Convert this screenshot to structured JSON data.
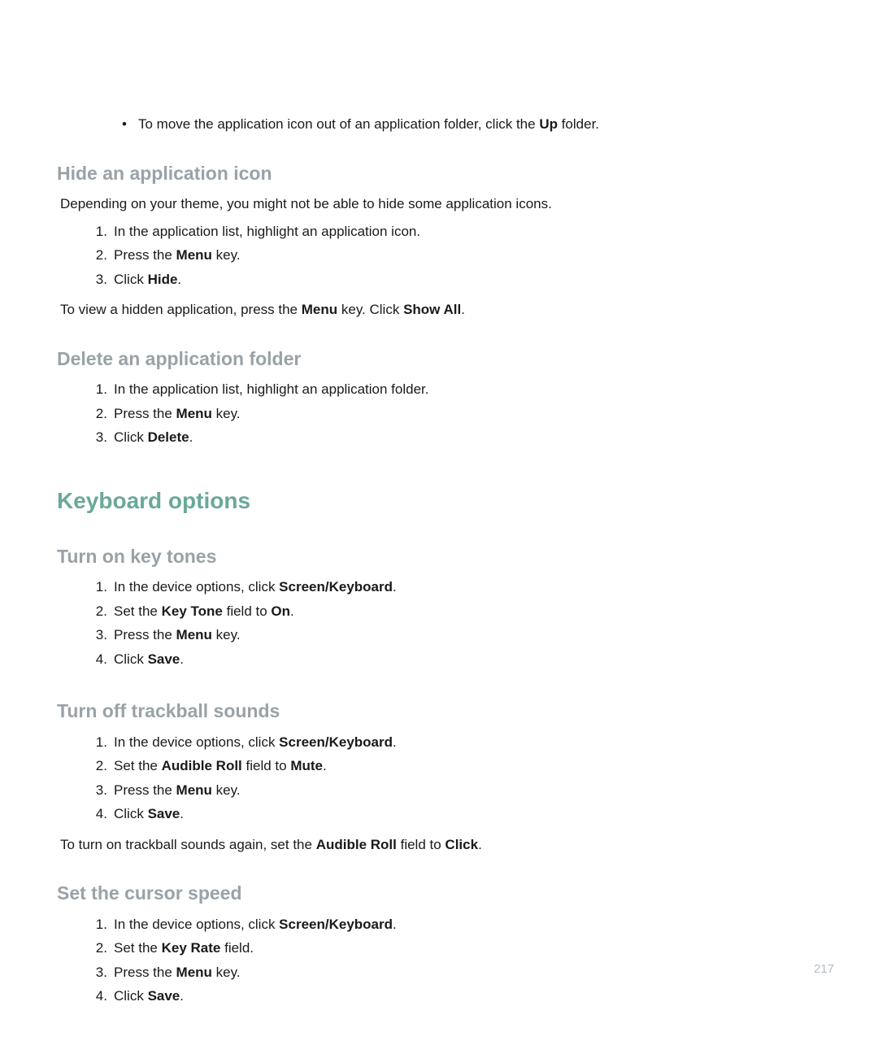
{
  "intro_bullet": {
    "prefix": "To move the application icon out of an application folder, click the ",
    "bold": "Up",
    "suffix": " folder."
  },
  "sec1": {
    "title": "Hide an application icon",
    "para1": "Depending on your theme, you might not be able to hide some application icons.",
    "step1": "In the application list, highlight an application icon.",
    "step2_prefix": "Press the ",
    "step2_bold": "Menu",
    "step2_suffix": " key.",
    "step3_prefix": "Click ",
    "step3_bold": "Hide",
    "step3_suffix": ".",
    "para2_prefix": "To view a hidden application, press the ",
    "para2_bold1": "Menu",
    "para2_mid": " key. Click ",
    "para2_bold2": "Show All",
    "para2_suffix": "."
  },
  "sec2": {
    "title": "Delete an application folder",
    "step1": "In the application list, highlight an application folder.",
    "step2_prefix": "Press the ",
    "step2_bold": "Menu",
    "step2_suffix": " key.",
    "step3_prefix": "Click ",
    "step3_bold": "Delete",
    "step3_suffix": "."
  },
  "main_heading": "Keyboard options",
  "sec3": {
    "title": "Turn on key tones",
    "step1_prefix": "In the device options, click ",
    "step1_bold": "Screen/Keyboard",
    "step1_suffix": ".",
    "step2_prefix": "Set the ",
    "step2_bold1": "Key Tone",
    "step2_mid": " field to ",
    "step2_bold2": "On",
    "step2_suffix": ".",
    "step3_prefix": "Press the ",
    "step3_bold": "Menu",
    "step3_suffix": " key.",
    "step4_prefix": "Click ",
    "step4_bold": "Save",
    "step4_suffix": "."
  },
  "sec4": {
    "title": "Turn off trackball sounds",
    "step1_prefix": "In the device options, click ",
    "step1_bold": "Screen/Keyboard",
    "step1_suffix": ".",
    "step2_prefix": "Set the ",
    "step2_bold1": "Audible Roll",
    "step2_mid": " field to ",
    "step2_bold2": "Mute",
    "step2_suffix": ".",
    "step3_prefix": "Press the ",
    "step3_bold": "Menu",
    "step3_suffix": " key.",
    "step4_prefix": "Click ",
    "step4_bold": "Save",
    "step4_suffix": ".",
    "para_prefix": "To turn on trackball sounds again, set the ",
    "para_bold1": "Audible Roll",
    "para_mid": " field to ",
    "para_bold2": "Click",
    "para_suffix": "."
  },
  "sec5": {
    "title": "Set the cursor speed",
    "step1_prefix": "In the device options, click ",
    "step1_bold": "Screen/Keyboard",
    "step1_suffix": ".",
    "step2_prefix": "Set the ",
    "step2_bold": "Key Rate",
    "step2_suffix": " field.",
    "step3_prefix": "Press the ",
    "step3_bold": "Menu",
    "step3_suffix": " key.",
    "step4_prefix": "Click ",
    "step4_bold": "Save",
    "step4_suffix": "."
  },
  "page_number": "217"
}
